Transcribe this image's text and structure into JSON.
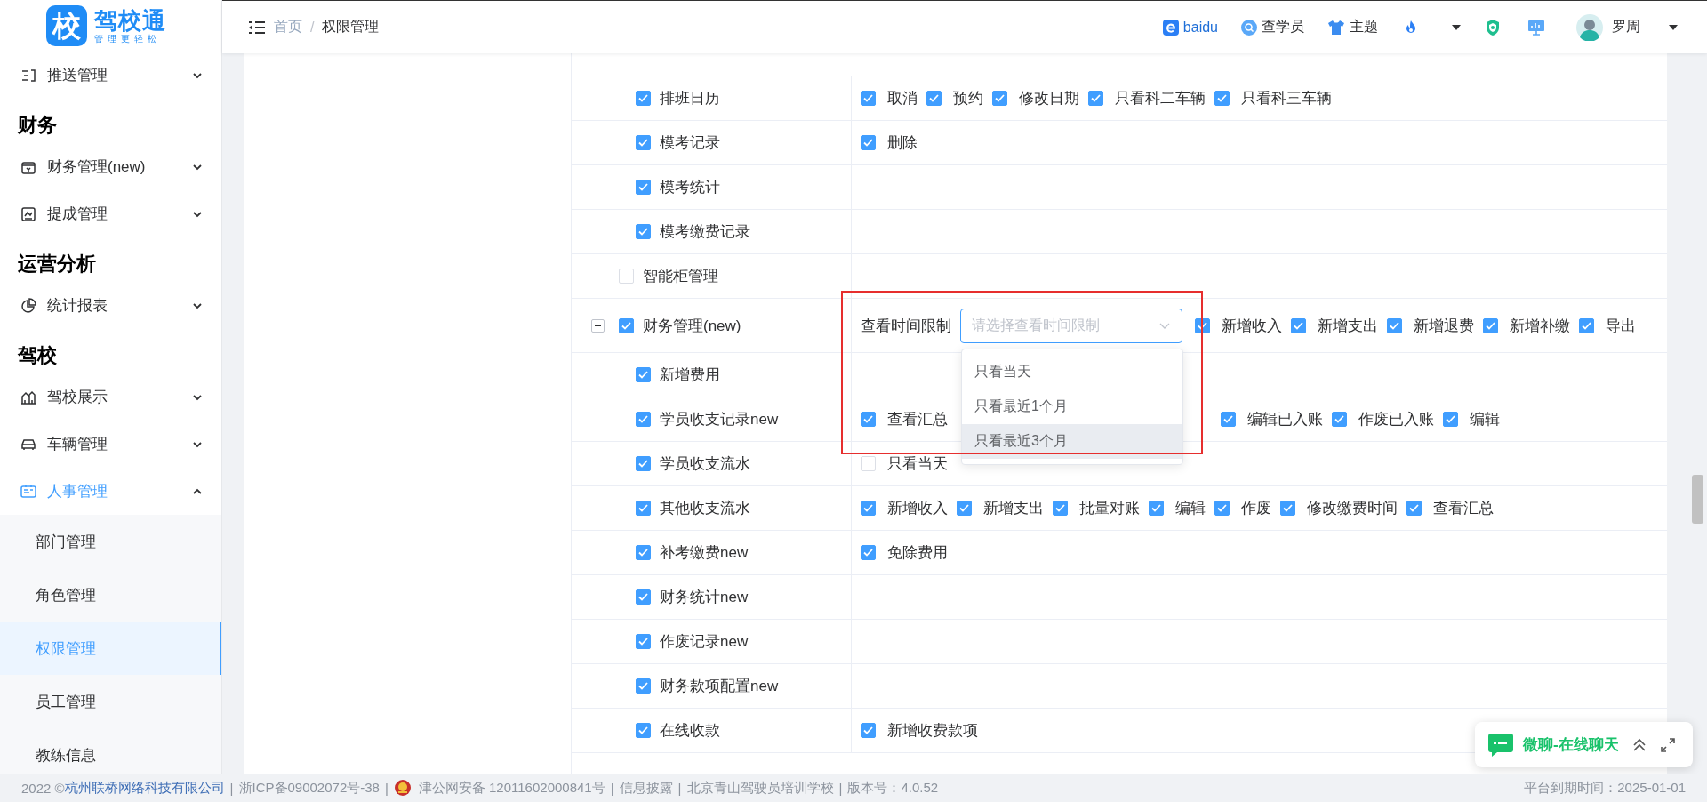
{
  "logo": {
    "badge": "校",
    "name": "驾校通",
    "tagline": "管理更轻松"
  },
  "sidebar": {
    "items": [
      {
        "kind": "item",
        "label": "推送管理",
        "expanded": false
      },
      {
        "kind": "heading",
        "label": "财务"
      },
      {
        "kind": "item",
        "label": "财务管理(new)",
        "expanded": false
      },
      {
        "kind": "item",
        "label": "提成管理",
        "expanded": false
      },
      {
        "kind": "heading",
        "label": "运营分析"
      },
      {
        "kind": "item",
        "label": "统计报表",
        "expanded": false
      },
      {
        "kind": "heading",
        "label": "驾校"
      },
      {
        "kind": "item",
        "label": "驾校展示",
        "expanded": false
      },
      {
        "kind": "item",
        "label": "车辆管理",
        "expanded": false
      },
      {
        "kind": "item",
        "label": "人事管理",
        "expanded": true,
        "children": [
          {
            "label": "部门管理",
            "selected": false
          },
          {
            "label": "角色管理",
            "selected": false
          },
          {
            "label": "权限管理",
            "selected": true
          },
          {
            "label": "员工管理",
            "selected": false
          },
          {
            "label": "教练信息",
            "selected": false
          }
        ]
      }
    ]
  },
  "topbar": {
    "breadcrumb": [
      "首页",
      "权限管理"
    ],
    "separator": "/",
    "links": [
      {
        "label": "baidu"
      },
      {
        "label": "查学员"
      },
      {
        "label": "主题"
      }
    ],
    "user": {
      "name": "罗周"
    }
  },
  "permissions": [
    {
      "children": [
        {
          "label": "排班日历",
          "checked": true,
          "actions": [
            {
              "label": "取消",
              "checked": true
            },
            {
              "label": "预约",
              "checked": true
            },
            {
              "label": "修改日期",
              "checked": true
            },
            {
              "label": "只看科二车辆",
              "checked": true
            },
            {
              "label": "只看科三车辆",
              "checked": true
            }
          ]
        },
        {
          "label": "模考记录",
          "checked": true,
          "actions": [
            {
              "label": "删除",
              "checked": true
            }
          ]
        },
        {
          "label": "模考统计",
          "checked": true
        },
        {
          "label": "模考缴费记录",
          "checked": true
        }
      ]
    },
    {
      "label": "智能柜管理",
      "checked": false
    },
    {
      "label": "财务管理(new)",
      "checked": true,
      "expanded": true,
      "time_limit": {
        "label": "查看时间限制",
        "placeholder": "请选择查看时间限制",
        "open": true,
        "framed": true,
        "options": [
          {
            "label": "只看当天",
            "highlighted": false
          },
          {
            "label": "只看最近1个月",
            "highlighted": false
          },
          {
            "label": "只看最近3个月",
            "highlighted": true
          }
        ]
      },
      "actions": [
        {
          "label": "新增收入",
          "checked": true
        },
        {
          "label": "新增支出",
          "checked": true
        },
        {
          "label": "新增退费",
          "checked": true
        },
        {
          "label": "新增补缴",
          "checked": true
        },
        {
          "label": "导出",
          "checked": true
        }
      ],
      "children": [
        {
          "label": "新增费用",
          "checked": true
        },
        {
          "label": "学员收支记录new",
          "checked": true,
          "actions": [
            {
              "label": "查看汇总",
              "checked": true
            }
          ],
          "actions_after_menu": [
            {
              "label": "编辑已入账",
              "checked": true
            },
            {
              "label": "作废已入账",
              "checked": true
            },
            {
              "label": "编辑",
              "checked": true
            }
          ]
        },
        {
          "label": "学员收支流水",
          "checked": true,
          "actions": [
            {
              "label": "只看当天",
              "checked": false
            }
          ]
        },
        {
          "label": "其他收支流水",
          "checked": true,
          "actions": [
            {
              "label": "新增收入",
              "checked": true
            },
            {
              "label": "新增支出",
              "checked": true
            },
            {
              "label": "批量对账",
              "checked": true
            },
            {
              "label": "编辑",
              "checked": true
            },
            {
              "label": "作废",
              "checked": true
            },
            {
              "label": "修改缴费时间",
              "checked": true
            },
            {
              "label": "查看汇总",
              "checked": true
            }
          ]
        },
        {
          "label": "补考缴费new",
          "checked": true,
          "actions": [
            {
              "label": "免除费用",
              "checked": true
            }
          ]
        },
        {
          "label": "财务统计new",
          "checked": true
        },
        {
          "label": "作废记录new",
          "checked": true
        },
        {
          "label": "财务款项配置new",
          "checked": true
        },
        {
          "label": "在线收款",
          "checked": true,
          "actions": [
            {
              "label": "新增收费款项",
              "checked": true
            }
          ]
        }
      ]
    }
  ],
  "chat": {
    "label": "微聊-在线聊天"
  },
  "footer": {
    "separator": "|",
    "copyright": "2022 ©",
    "company": "杭州联桥网络科技有限公司",
    "icp": "浙ICP备09002072号-38",
    "police": "津公网安备 12011602000841号",
    "links": [
      "信息披露",
      "北京青山驾驶员培训学校"
    ],
    "version": "版本号：4.0.52",
    "expiry": "平台到期时间：2025-01-01"
  }
}
